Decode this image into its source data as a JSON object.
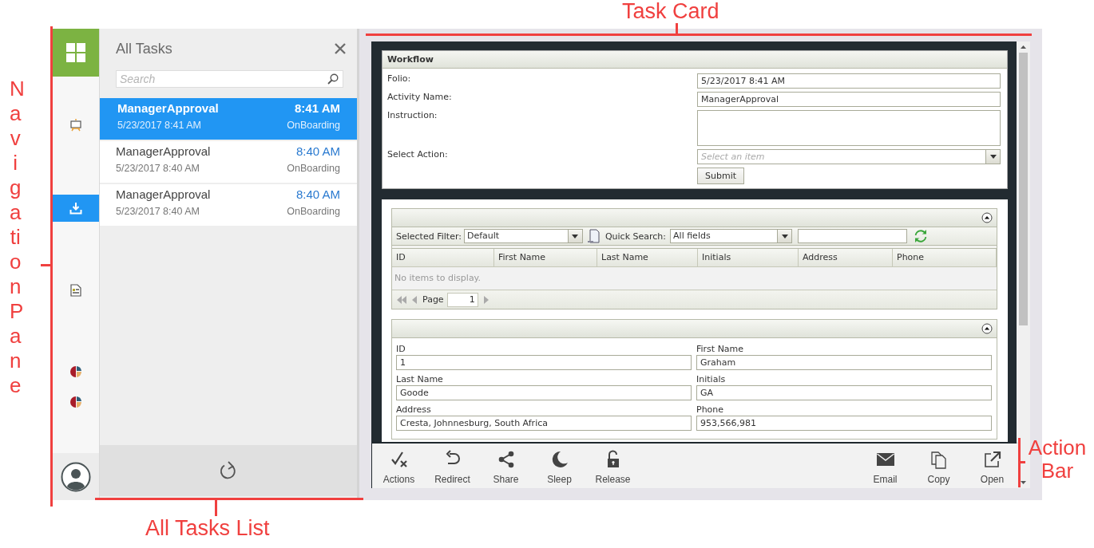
{
  "annotations": [
    {
      "kind": "left",
      "text": "Navigation Pane"
    },
    {
      "kind": "top",
      "text": "Task Card"
    },
    {
      "kind": "bottom",
      "text": "All Tasks List"
    },
    {
      "kind": "right",
      "text": "Action Bar"
    }
  ],
  "nav": {
    "items": [
      {
        "kind": "home",
        "selected": false
      },
      {
        "kind": "easel",
        "selected": false
      },
      {
        "kind": "download",
        "selected": true
      },
      {
        "kind": "document",
        "selected": false
      },
      {
        "kind": "pie",
        "selected": false
      },
      {
        "kind": "pie",
        "selected": false
      },
      {
        "kind": "user",
        "selected": false
      }
    ]
  },
  "task_list": {
    "title": "All Tasks",
    "search": {
      "placeholder": "Search"
    },
    "tasks": [
      {
        "name": "ManagerApproval",
        "time": "8:41 AM",
        "date": "5/23/2017 8:41 AM",
        "process": "OnBoarding",
        "selected": true
      },
      {
        "name": "ManagerApproval",
        "time": "8:40 AM",
        "date": "5/23/2017 8:40 AM",
        "process": "OnBoarding",
        "selected": false
      },
      {
        "name": "ManagerApproval",
        "time": "8:40 AM",
        "date": "5/23/2017 8:40 AM",
        "process": "OnBoarding",
        "selected": false
      }
    ]
  },
  "task_card": {
    "workflow": {
      "title": "Workflow",
      "fields": [
        {
          "kind": "text",
          "label": "Folio:",
          "value": "5/23/2017 8:41 AM"
        },
        {
          "kind": "text",
          "label": "Activity Name:",
          "value": "ManagerApproval"
        },
        {
          "kind": "textarea",
          "label": "Instruction:"
        },
        {
          "kind": "select",
          "label": "Select Action:",
          "placeholder": "Select an item"
        }
      ],
      "submit": "Submit"
    },
    "list_view": {
      "filter_label": "Selected Filter:",
      "filter_value": "Default",
      "quick_search_label": "Quick Search:",
      "quick_search_value": "All fields",
      "columns": [
        "ID",
        "First Name",
        "Last Name",
        "Initials",
        "Address",
        "Phone"
      ],
      "empty_text": "No items to display.",
      "page_label": "Page",
      "page_value": "1"
    },
    "detail_form": {
      "fields": [
        {
          "label": "ID",
          "value": "1"
        },
        {
          "label": "First Name",
          "value": "Graham"
        },
        {
          "label": "Last Name",
          "value": "Goode"
        },
        {
          "label": "Initials",
          "value": "GA"
        },
        {
          "label": "Address",
          "value": "Cresta, Johnnesburg, South Africa"
        },
        {
          "label": "Phone",
          "value": "953,566,981"
        }
      ]
    }
  },
  "action_bar": {
    "left": [
      {
        "kind": "actions",
        "label": "Actions"
      },
      {
        "kind": "redirect",
        "label": "Redirect"
      },
      {
        "kind": "share",
        "label": "Share"
      },
      {
        "kind": "sleep",
        "label": "Sleep"
      },
      {
        "kind": "release",
        "label": "Release"
      }
    ],
    "right": [
      {
        "kind": "email",
        "label": "Email"
      },
      {
        "kind": "copy",
        "label": "Copy"
      },
      {
        "kind": "open",
        "label": "Open"
      }
    ]
  }
}
